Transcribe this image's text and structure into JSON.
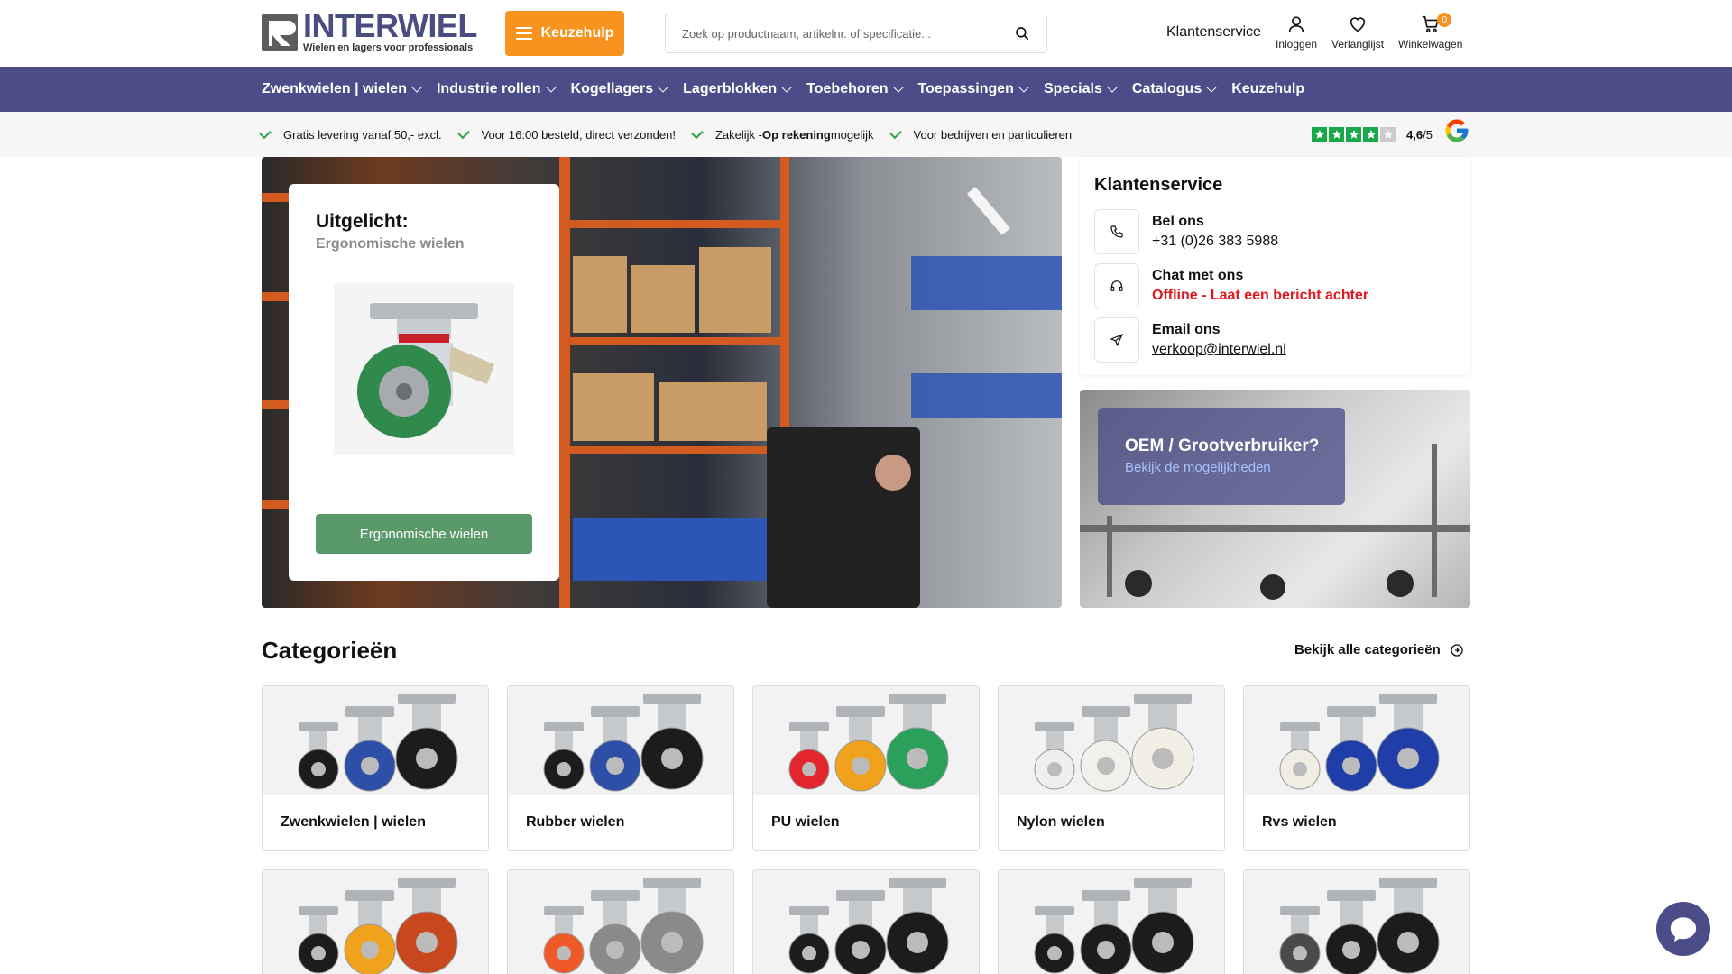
{
  "header": {
    "logo_name": "INTERWIEL",
    "logo_tagline": "Wielen en lagers voor professionals",
    "keuzehulp_label": "Keuzehulp",
    "search_placeholder": "Zoek op productnaam, artikelnr. of specificatie...",
    "klantenservice_label": "Klantenservice",
    "login_label": "Inloggen",
    "wishlist_label": "Verlanglijst",
    "cart_label": "Winkelwagen",
    "cart_count": "0"
  },
  "nav": {
    "items": [
      {
        "label": "Zwenkwielen | wielen",
        "dropdown": true
      },
      {
        "label": "Industrie rollen",
        "dropdown": true
      },
      {
        "label": "Kogellagers",
        "dropdown": true
      },
      {
        "label": "Lagerblokken",
        "dropdown": true
      },
      {
        "label": "Toebehoren",
        "dropdown": true
      },
      {
        "label": "Toepassingen",
        "dropdown": true
      },
      {
        "label": "Specials",
        "dropdown": true
      },
      {
        "label": "Catalogus",
        "dropdown": true
      },
      {
        "label": "Keuzehulp",
        "dropdown": false
      }
    ]
  },
  "usp": {
    "items": [
      "Gratis levering vanaf 50,- excl.",
      "Voor 16:00 besteld, direct verzonden!",
      "Voor bedrijven en particulieren"
    ],
    "zakelijk_prefix": "Zakelijk - ",
    "zakelijk_bold": "Op rekening",
    "zakelijk_suffix": " mogelijk",
    "rating_value": "4,6",
    "rating_scale": "/5",
    "stars_filled": 4,
    "stars_total": 5
  },
  "hero": {
    "title": "Uitgelicht:",
    "subtitle": "Ergonomische wielen",
    "button_label": "Ergonomische wielen"
  },
  "klantenservice": {
    "title": "Klantenservice",
    "phone_label": "Bel ons",
    "phone_value": "+31 (0)26 383 5988",
    "chat_label": "Chat met ons",
    "chat_value": "Offline - Laat een bericht achter",
    "email_label": "Email ons",
    "email_value": "verkoop@interwiel.nl"
  },
  "oem": {
    "title": "OEM / Grootverbruiker?",
    "link": "Bekijk de mogelijkheden"
  },
  "categories": {
    "title": "Categorieën",
    "view_all": "Bekijk alle categorieën",
    "items": [
      {
        "name": "Zwenkwielen | wielen",
        "wheel_colors": [
          "#1c1c1c",
          "#2e4fa8",
          "#1c1c1c"
        ]
      },
      {
        "name": "Rubber wielen",
        "wheel_colors": [
          "#1c1c1c",
          "#2e4fa8",
          "#1c1c1c"
        ]
      },
      {
        "name": "PU wielen",
        "wheel_colors": [
          "#e3262d",
          "#f0a21c",
          "#2aa05a"
        ]
      },
      {
        "name": "Nylon wielen",
        "wheel_colors": [
          "#efefef",
          "#f2f0ea",
          "#f2efe4"
        ]
      },
      {
        "name": "Rvs wielen",
        "wheel_colors": [
          "#f0ede2",
          "#1f3ea8",
          "#1f3ea8"
        ]
      }
    ],
    "row2_wheel_colors": [
      [
        "#1c1c1c",
        "#f0a21c",
        "#c8471d"
      ],
      [
        "#f05a28",
        "#8a8a8a",
        "#8a8a8a"
      ],
      [
        "#1c1c1c",
        "#1c1c1c",
        "#1c1c1c"
      ],
      [
        "#1c1c1c",
        "#1c1c1c",
        "#1c1c1c"
      ],
      [
        "#4a4a4a",
        "#1c1c1c",
        "#1c1c1c"
      ]
    ]
  },
  "colors": {
    "brand": "#4a4d87",
    "accent": "#f7931e",
    "success": "#2ea34a",
    "offline": "#e3161e",
    "hero_button": "#5a9a6a"
  }
}
